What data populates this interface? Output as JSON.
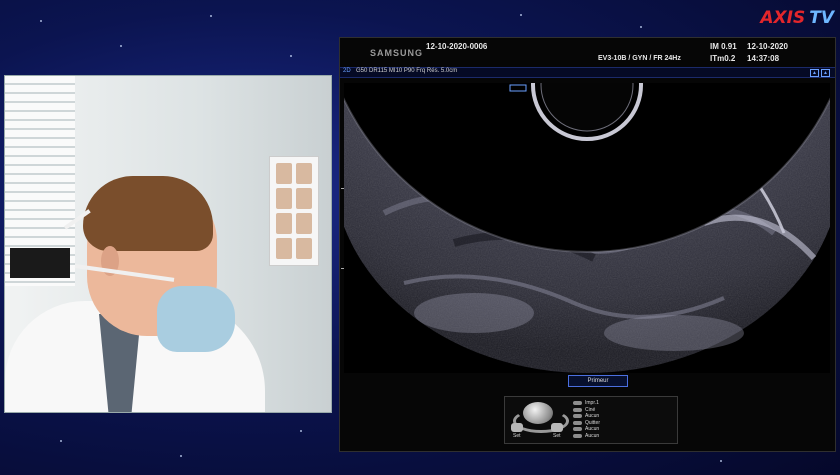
{
  "logo": {
    "brand": "AXIS",
    "suffix": "TV"
  },
  "ultrasound": {
    "brand": "SAMSUNG",
    "patient_id": "12-10-2020-0006",
    "probe_info": "EV3-10B / GYN / FR 24Hz",
    "mi": "IM  0.91",
    "ti": "ITm0.2",
    "date": "12-10-2020",
    "time": "14:37:08",
    "mode": "2D",
    "params": "G50 DR115 MI10 P90 Frq Rés. 5.0cm",
    "depth_marks": [
      "2",
      "4"
    ],
    "preset_button": "Primeur",
    "menu": [
      "Impr.1",
      "Ciné",
      "Aucun",
      "Quitter",
      "Aucun",
      "Aucun"
    ],
    "set_left": "Set",
    "set_right": "Set"
  },
  "colors": {
    "background": "#0b1450",
    "logo_red": "#e3262b",
    "logo_blue": "#6fb7ff"
  }
}
